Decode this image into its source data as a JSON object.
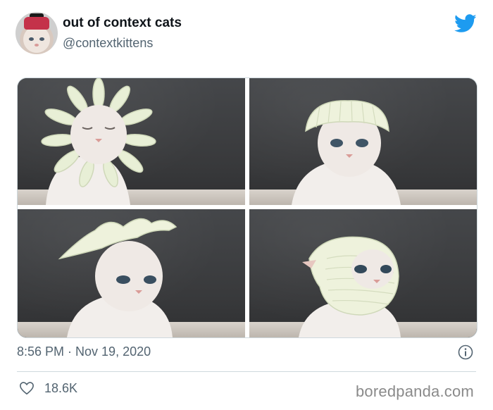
{
  "tweet": {
    "author": {
      "display_name": "out of context cats",
      "handle": "@contextkittens",
      "avatar_icon": "cat-avatar"
    },
    "brand_icon": "twitter-bird-icon",
    "brand_color": "#1d9bf0",
    "media": {
      "photo_count": 4,
      "photos": [
        {
          "subject": "white cat with flower-shaped hat"
        },
        {
          "subject": "white cat with bonnet-style hat"
        },
        {
          "subject": "white cat with crown-shaped hat"
        },
        {
          "subject": "white cat with hood-style hat"
        }
      ]
    },
    "timestamp": "8:56 PM · Nov 19, 2020",
    "info_icon": "info-icon",
    "likes": {
      "icon": "heart-icon",
      "count": "18.6K"
    }
  },
  "watermark": "boredpanda.com"
}
